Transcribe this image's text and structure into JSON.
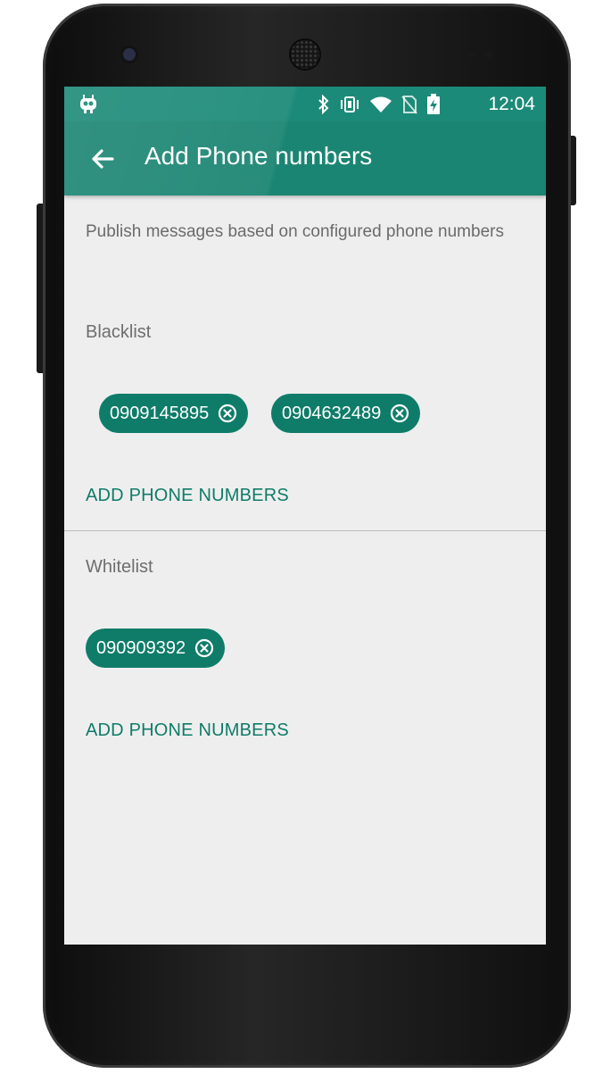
{
  "status_bar": {
    "time": "12:04"
  },
  "app_bar": {
    "title": "Add Phone numbers",
    "back_icon": "arrow-back-icon"
  },
  "description": "Publish messages based on configured phone numbers",
  "blacklist": {
    "label": "Blacklist",
    "numbers": [
      "0909145895",
      "0904632489"
    ],
    "add_label": "ADD PHONE NUMBERS"
  },
  "whitelist": {
    "label": "Whitelist",
    "numbers": [
      "090909392"
    ],
    "add_label": "ADD PHONE NUMBERS"
  },
  "colors": {
    "primary": "#1b8573",
    "chip": "#0f7c69",
    "background": "#eeeeee"
  }
}
